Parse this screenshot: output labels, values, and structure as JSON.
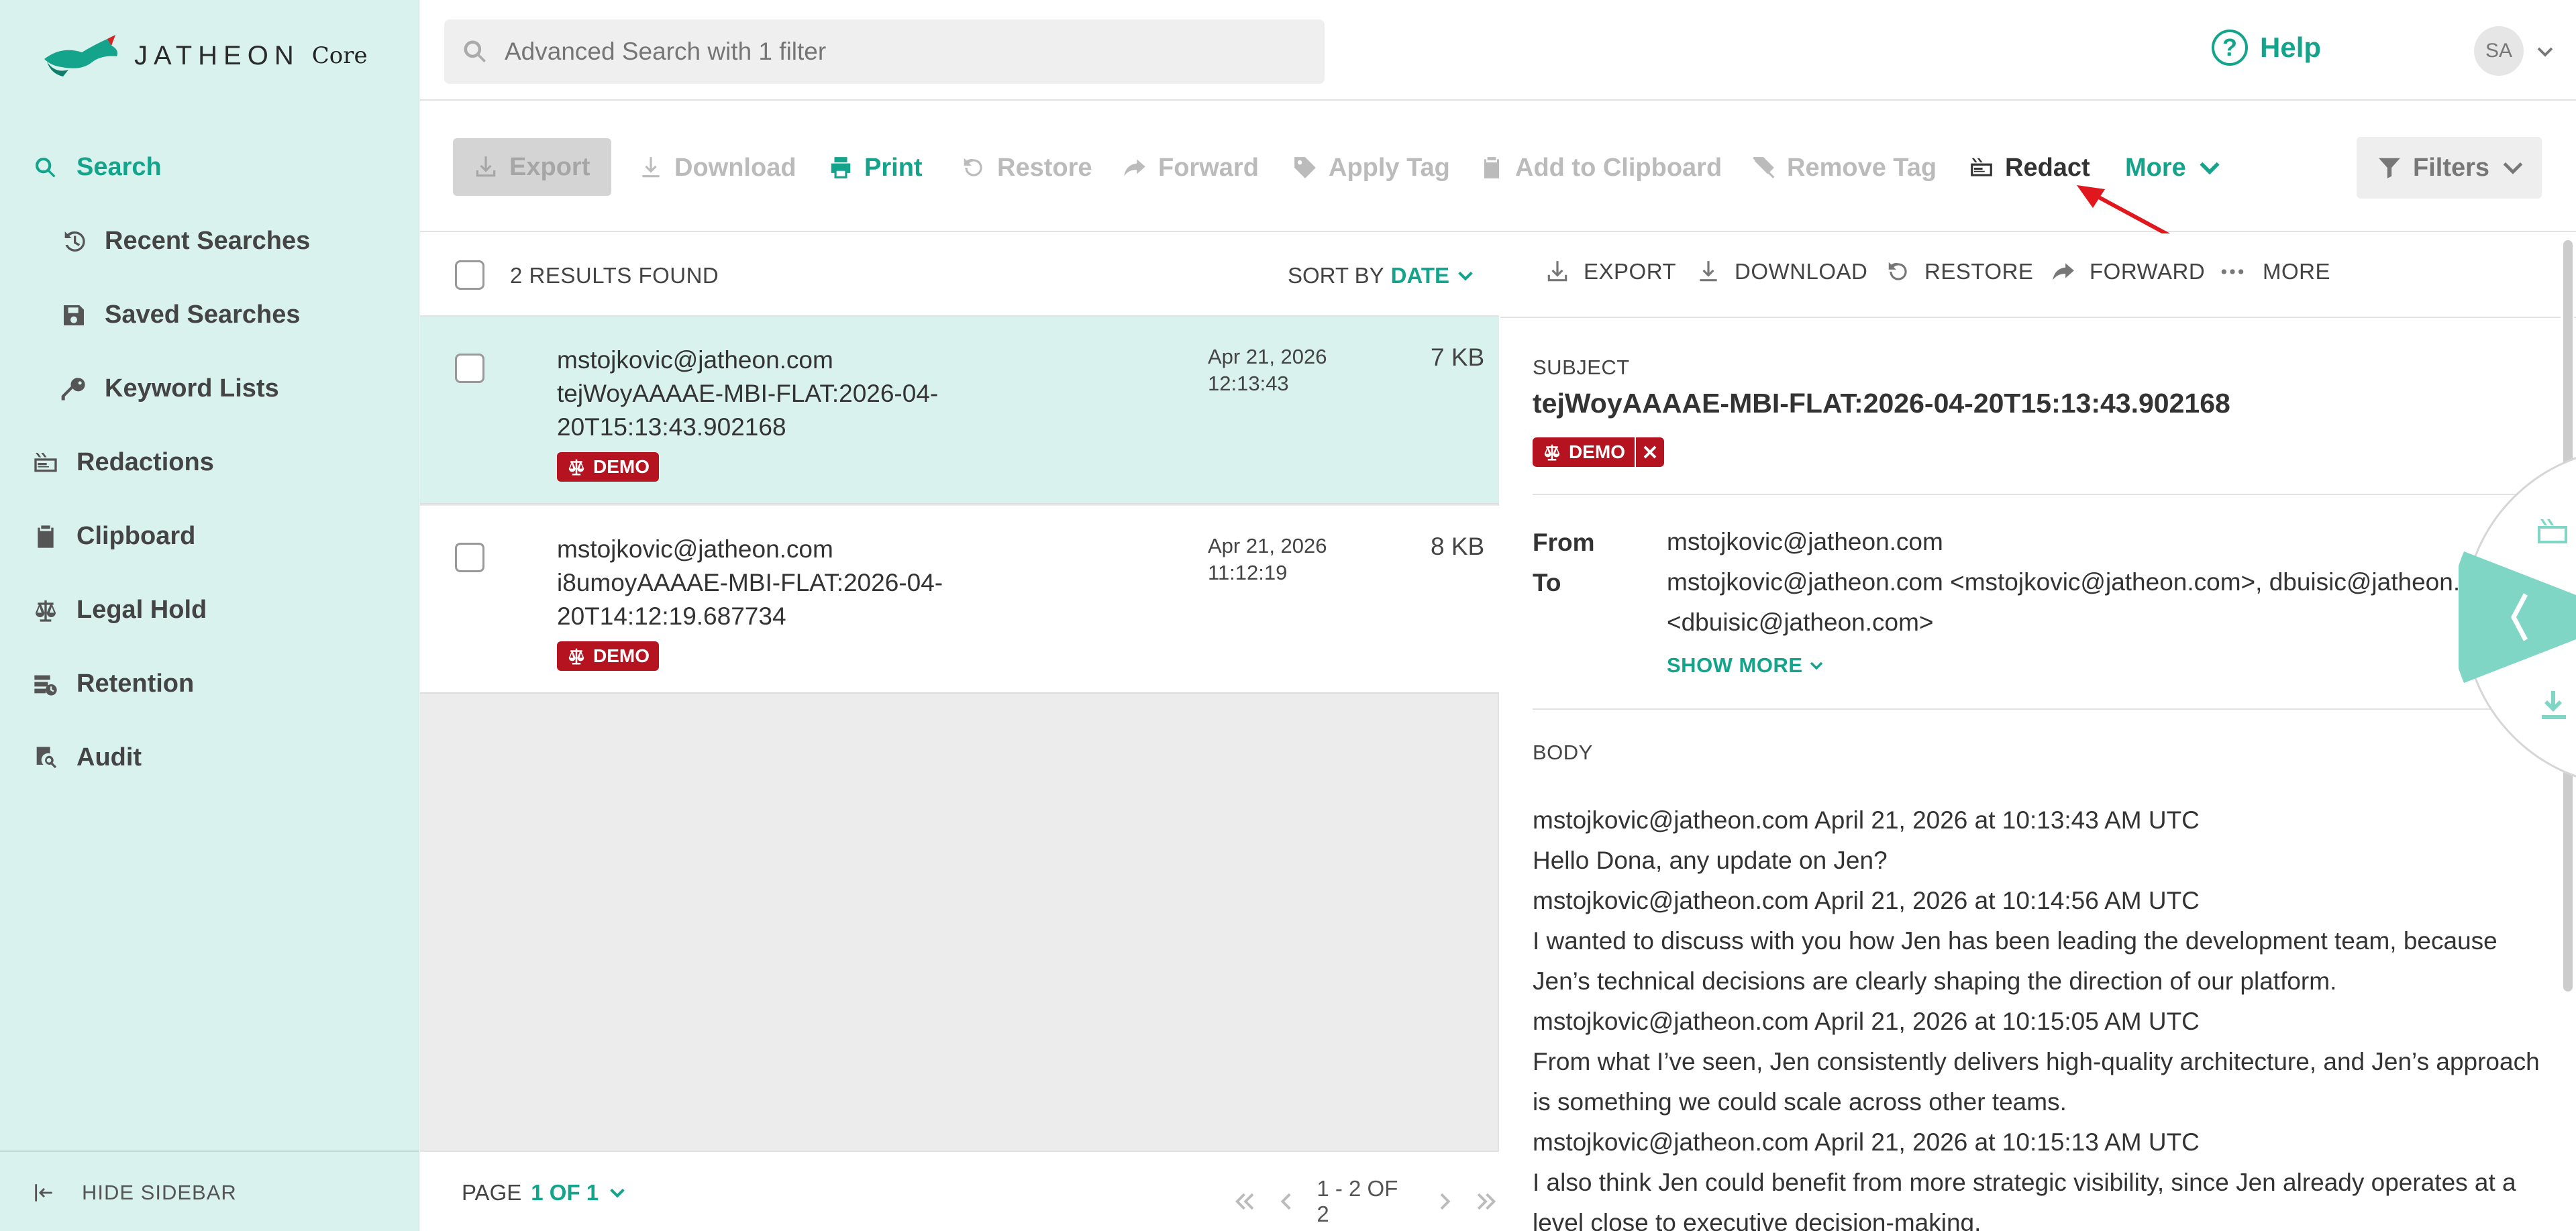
{
  "brand": {
    "logo_text": "JATHEON",
    "product": "Core"
  },
  "sidebar": {
    "items": [
      {
        "label": "Search",
        "icon": "search-icon"
      },
      {
        "label": "Recent Searches",
        "icon": "history-icon"
      },
      {
        "label": "Saved Searches",
        "icon": "save-icon"
      },
      {
        "label": "Keyword Lists",
        "icon": "key-icon"
      },
      {
        "label": "Redactions",
        "icon": "redact-icon"
      },
      {
        "label": "Clipboard",
        "icon": "clipboard-icon"
      },
      {
        "label": "Legal Hold",
        "icon": "scale-icon"
      },
      {
        "label": "Retention",
        "icon": "retention-icon"
      },
      {
        "label": "Audit",
        "icon": "audit-icon"
      }
    ],
    "hide_label": "HIDE SIDEBAR"
  },
  "header": {
    "search_placeholder": "Advanced Search with 1 filter",
    "help_label": "Help",
    "avatar_initials": "SA"
  },
  "toolbar": {
    "export": "Export",
    "download": "Download",
    "print": "Print",
    "restore": "Restore",
    "forward": "Forward",
    "apply_tag": "Apply Tag",
    "add_to_clipboard": "Add to Clipboard",
    "remove_tag": "Remove Tag",
    "redact": "Redact",
    "more": "More",
    "filters": "Filters"
  },
  "results": {
    "count_label": "2 RESULTS FOUND",
    "sort_label": "SORT BY",
    "sort_value": "DATE",
    "rows": [
      {
        "from": "mstojkovic@jatheon.com",
        "subject_line1": "tejWoyAAAAE-MBI-FLAT:2026-04-",
        "subject_line2": "20T15:13:43.902168",
        "date": "Apr 21, 2026",
        "time": "12:13:43",
        "size": "7 KB",
        "tag": "DEMO"
      },
      {
        "from": "mstojkovic@jatheon.com",
        "subject_line1": "i8umoyAAAAE-MBI-FLAT:2026-04-",
        "subject_line2": "20T14:12:19.687734",
        "date": "Apr 21, 2026",
        "time": "11:12:19",
        "size": "8 KB",
        "tag": "DEMO"
      }
    ],
    "page_label": "PAGE",
    "page_value": "1 OF 1",
    "range": "1 - 2 OF 2"
  },
  "detail": {
    "toolbar": {
      "export": "EXPORT",
      "download": "DOWNLOAD",
      "restore": "RESTORE",
      "forward": "FORWARD",
      "more": "MORE"
    },
    "subject_label": "SUBJECT",
    "subject": "tejWoyAAAAE-MBI-FLAT:2026-04-20T15:13:43.902168",
    "tag": "DEMO",
    "from_label": "From",
    "from": "mstojkovic@jatheon.com",
    "to_label": "To",
    "to_line1": "mstojkovic@jatheon.com <mstojkovic@jatheon.com>, dbuisic@jatheon.com",
    "to_line2": "<dbuisic@jatheon.com>",
    "show_more": "SHOW MORE",
    "body_label": "BODY",
    "body_lines": [
      "mstojkovic@jatheon.com April 21, 2026 at 10:13:43 AM UTC",
      "Hello Dona, any update on Jen?",
      "mstojkovic@jatheon.com April 21, 2026 at 10:14:56 AM UTC",
      "I wanted to discuss with you how Jen has been leading the development team, because",
      "Jen’s technical decisions are clearly shaping the direction of our platform.",
      "mstojkovic@jatheon.com April 21, 2026 at 10:15:05 AM UTC",
      "From what I’ve seen, Jen consistently delivers high-quality architecture, and Jen’s approach",
      "is something we could scale across other teams.",
      "mstojkovic@jatheon.com April 21, 2026 at 10:15:13 AM UTC",
      "I also think Jen could benefit from more strategic visibility, since Jen already operates at a",
      "level close to executive decision-making."
    ]
  },
  "colors": {
    "accent": "#14a38b",
    "sidebar_bg": "#d9f2ee",
    "tag_red": "#b5131f",
    "annotation_red": "#e0171d"
  }
}
